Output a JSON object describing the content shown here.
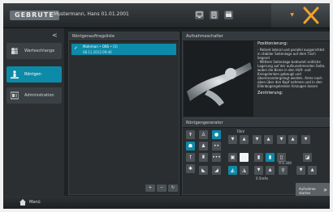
{
  "header": {
    "logo_text": "GEBRUTE",
    "patient_info": "Mustermann, Hans  01.01.2001",
    "icons": [
      "monitor-icon",
      "document-icon",
      "printer-icon"
    ],
    "brand_color": "#f1a12a"
  },
  "sidebar": {
    "collapse_label": "<",
    "items": [
      {
        "label": "Warteschlange",
        "icon": "patient-queue-icon",
        "active": false
      },
      {
        "label": "Röntgen",
        "icon": "xray-person-icon",
        "active": true
      },
      {
        "label": "Administration",
        "icon": "admin-icon",
        "active": false
      }
    ]
  },
  "orders": {
    "title": "Röntgenauftragsliste",
    "rows": [
      {
        "line1": "Mahrman  •  OBS  •  (1)",
        "line2": "08.11.2013  09:46",
        "checked": true
      }
    ],
    "buttons": [
      "+",
      "−",
      "↻"
    ]
  },
  "recording": {
    "title": "Aufnahmeschalter",
    "positioning_heading": "Positionierung:",
    "positioning_lines": [
      "- Patient lateral und parallel ausgerichtet",
      "in stabiler Seitenlage auf dem Tisch",
      "liegend",
      "- Mittlere Seitenlage bedeutet seitliche",
      "Lagerung auf der aufzunehmenden Seite,",
      "wobei die Beine in den Hüft- und",
      "Kniegelenken gebeugt und",
      "übereinandergelegt werden. Arme nach",
      "oben über den Kopf nehmen und in den",
      "Ellenbogengelenken hinzugen lassen"
    ],
    "centering_heading": "Zentrierung:"
  },
  "generator": {
    "title": "Röntgengenerator",
    "kv_label": "70kV",
    "mas_label": "0.5mAs",
    "focus_label": "FFS 200"
  },
  "footer": {
    "menu_label": "Menü",
    "start_label_1": "Aufnahme",
    "start_label_2": "starten",
    "accent_color": "#0d8aa8"
  }
}
